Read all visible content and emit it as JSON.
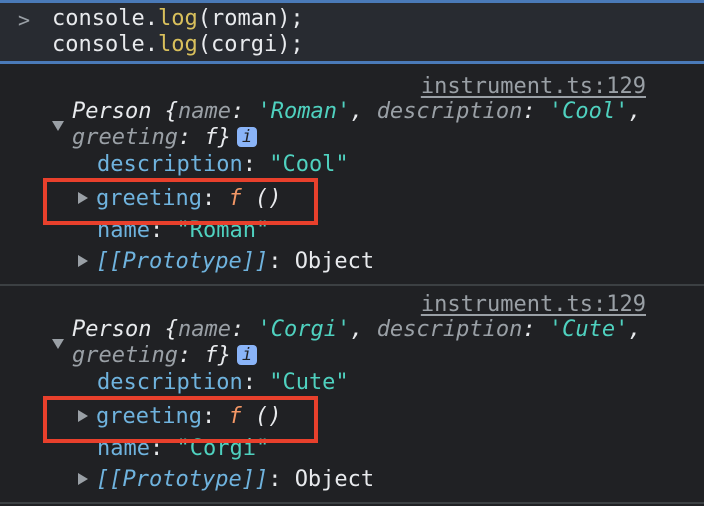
{
  "input": {
    "prompt_icon": "chevron-right-icon",
    "lines": [
      {
        "obj": "console.",
        "method": "log",
        "args": "(roman);"
      },
      {
        "obj": "console.",
        "method": "log",
        "args": "(corgi);"
      }
    ]
  },
  "logs": [
    {
      "source": "instrument.ts:129",
      "class_name": "Person",
      "preview_name_key": "name",
      "preview_name_val": "'Roman'",
      "preview_desc_key": "description",
      "preview_desc_val": "'Cool'",
      "preview_greeting_key": "greeting",
      "preview_greeting_val": "f",
      "info_label": "i",
      "description_key": "description",
      "description_val": "\"Cool\"",
      "greeting_key": "greeting",
      "greeting_f": "f",
      "greeting_parens": "()",
      "name_key": "name",
      "name_val": "\"Roman\"",
      "prototype_key": "[[Prototype]]",
      "prototype_val": "Object"
    },
    {
      "source": "instrument.ts:129",
      "class_name": "Person",
      "preview_name_key": "name",
      "preview_name_val": "'Corgi'",
      "preview_desc_key": "description",
      "preview_desc_val": "'Cute'",
      "preview_greeting_key": "greeting",
      "preview_greeting_val": "f",
      "info_label": "i",
      "description_key": "description",
      "description_val": "\"Cute\"",
      "greeting_key": "greeting",
      "greeting_f": "f",
      "greeting_parens": "()",
      "name_key": "name",
      "name_val": "\"Corgi\"",
      "prototype_key": "[[Prototype]]",
      "prototype_val": "Object"
    }
  ],
  "colors": {
    "highlight": "#e8402c",
    "string": "#4fd1bf",
    "key": "#6fb3de",
    "function": "#f29766",
    "accent": "#4a7ab8"
  }
}
